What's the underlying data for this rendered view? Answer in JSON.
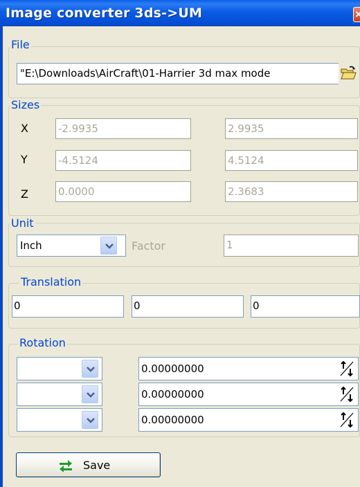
{
  "window": {
    "title": "Image converter 3ds->UM",
    "close_glyph": "×"
  },
  "file": {
    "legend": "File",
    "path": "\"E:\\Downloads\\AirCraft\\01-Harrier 3d max mode",
    "browse_icon": "folder-open-icon"
  },
  "sizes": {
    "legend": "Sizes",
    "rows": [
      {
        "axis": "X",
        "min": "-2.9935",
        "max": "2.9935"
      },
      {
        "axis": "Y",
        "min": "-4.5124",
        "max": "4.5124"
      },
      {
        "axis": "Z",
        "min": "0.0000",
        "max": "2.3683"
      }
    ]
  },
  "unit": {
    "legend": "Unit",
    "selected": "Inch",
    "factor_label": "Factor",
    "factor_value": "1"
  },
  "translation": {
    "legend": "Translation",
    "values": [
      "0",
      "0",
      "0"
    ]
  },
  "rotation": {
    "legend": "Rotation",
    "rows": [
      {
        "axis_selected": "",
        "angle": "0.00000000"
      },
      {
        "axis_selected": "",
        "angle": "0.00000000"
      },
      {
        "axis_selected": "",
        "angle": "0.00000000"
      }
    ]
  },
  "actions": {
    "save_label": "Save"
  },
  "colors": {
    "title_bar": "#0550D8",
    "legend_text": "#0046D5",
    "dialog_bg": "#ECE9D8"
  }
}
